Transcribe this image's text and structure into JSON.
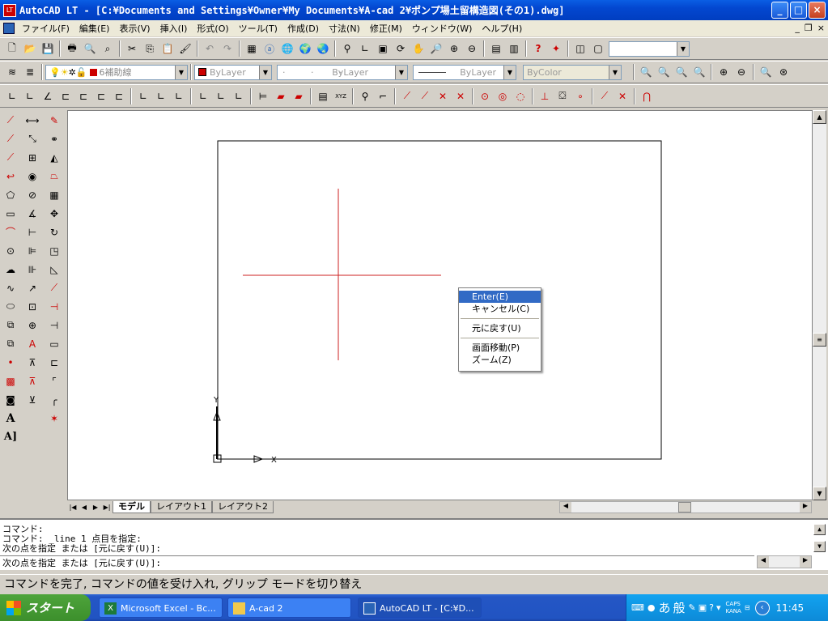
{
  "window": {
    "title": "AutoCAD LT - [C:¥Documents and Settings¥Owner¥My Documents¥A-cad 2¥ポンプ場土留構造図(その1).dwg]",
    "app_icon_text": "LT"
  },
  "menu": {
    "items": [
      "ファイル(F)",
      "編集(E)",
      "表示(V)",
      "挿入(I)",
      "形式(O)",
      "ツール(T)",
      "作成(D)",
      "寸法(N)",
      "修正(M)",
      "ウィンドウ(W)",
      "ヘルプ(H)"
    ]
  },
  "properties_bar": {
    "layer_name": "6補助線",
    "color": "ByLayer",
    "linetype": "ByLayer",
    "lineweight": "ByLayer",
    "plotstyle": "ByColor"
  },
  "context_menu": {
    "items": [
      {
        "label": "Enter(E)",
        "highlighted": true
      },
      {
        "label": "キャンセル(C)",
        "highlighted": false
      },
      {
        "label": "元に戻す(U)",
        "highlighted": false
      },
      {
        "label": "画面移動(P)",
        "highlighted": false
      },
      {
        "label": "ズーム(Z)",
        "highlighted": false
      }
    ]
  },
  "tabs": {
    "items": [
      "モデル",
      "レイアウト1",
      "レイアウト2"
    ],
    "active": "モデル"
  },
  "command": {
    "history": [
      "コマンド:",
      "コマンド: _line 1 点目を指定:",
      "次の点を指定 または [元に戻す(U)]:"
    ],
    "current": "次の点を指定 または [元に戻す(U)]:"
  },
  "status": {
    "text": "コマンドを完了, コマンドの値を受け入れ, グリップ モードを切り替え"
  },
  "taskbar": {
    "start_label": "スタート",
    "tasks": [
      {
        "label": "Microsoft Excel - Bc...",
        "active": false
      },
      {
        "label": "A-cad 2",
        "active": false
      },
      {
        "label": "AutoCAD LT - [C:¥D...",
        "active": true
      }
    ],
    "tray": {
      "ime_1": "あ",
      "ime_2": "般",
      "caps": "CAPS",
      "kana": "KANA",
      "clock": "11:45"
    }
  },
  "colors": {
    "drawing_red": "#cc2222",
    "titlebar_blue": "#0347d0",
    "highlight": "#316ac5"
  }
}
